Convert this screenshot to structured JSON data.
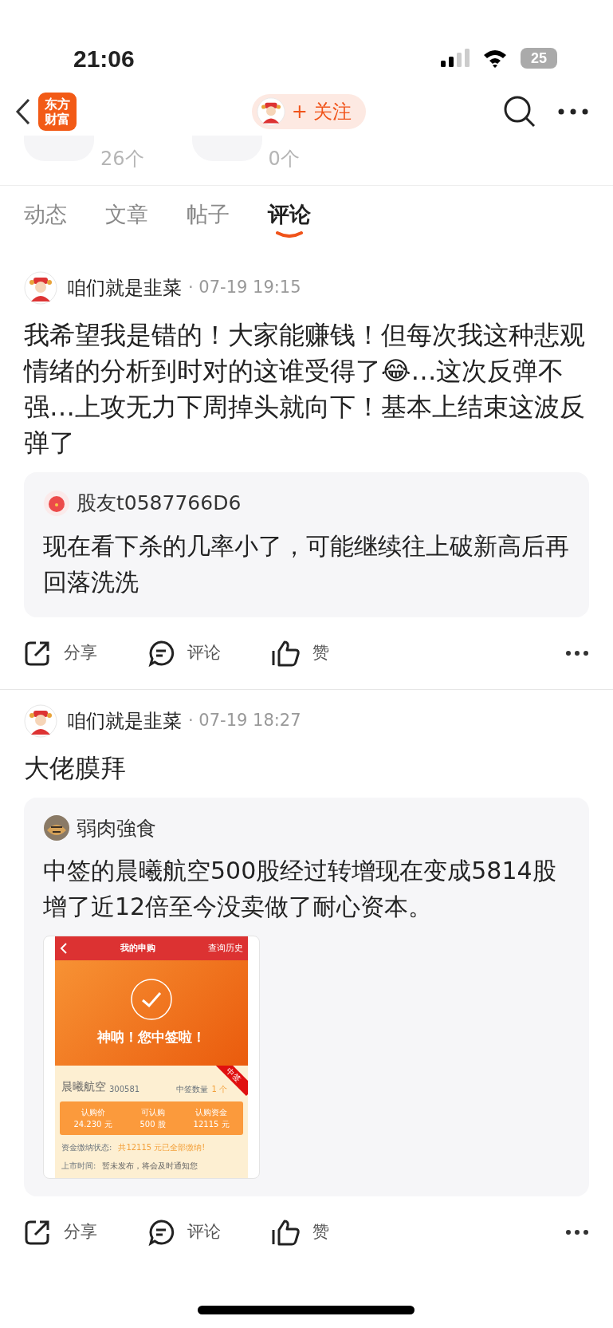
{
  "status_bar": {
    "time": "21:06",
    "battery": "25"
  },
  "header": {
    "logo_lines": [
      "东方",
      "财富"
    ],
    "follow_button": "+ 关注"
  },
  "stats": [
    {
      "count": "26个"
    },
    {
      "count": "0个"
    }
  ],
  "tabs": [
    {
      "label": "动态",
      "selected": false
    },
    {
      "label": "文章",
      "selected": false
    },
    {
      "label": "帖子",
      "selected": false
    },
    {
      "label": "评论",
      "selected": true
    }
  ],
  "posts": [
    {
      "author": "咱们就是韭菜",
      "time": "· 07-19 19:15",
      "text": "我希望我是错的！大家能赚钱！但每次我这种悲观情绪的分析到时对的这谁受得了😂…这次反弹不强…上攻无力下周掉头就向下！基本上结束这波反弹了",
      "quote": {
        "author": "股友t0587766D6",
        "text": "现在看下杀的几率小了，可能继续往上破新高后再回落洗洗"
      },
      "actions": [
        "分享",
        "评论",
        "赞"
      ]
    },
    {
      "author": "咱们就是韭菜",
      "time": "· 07-19 18:27",
      "text": "大佬膜拜",
      "quote": {
        "author": "弱肉強食",
        "text": "中签的晨曦航空500股经过转增现在变成5814股增了近12倍至今没卖做了耐心资本。",
        "screenshot": {
          "title": "我的申购",
          "link": "查询历史",
          "banner": "神呐！您中签啦！",
          "ribbon": "中签",
          "stock": "晨曦航空",
          "code": "300581",
          "count_label": "中签数量",
          "count": "1",
          "count_unit": "个",
          "fields": [
            {
              "label": "认购价",
              "value": "24.230",
              "unit": "元"
            },
            {
              "label": "可认购",
              "value": "500",
              "unit": "股"
            },
            {
              "label": "认购资金",
              "value": "12115",
              "unit": "元"
            }
          ],
          "status": [
            {
              "label": "资金缴纳状态:",
              "value": "共12115 元已全部缴纳!"
            },
            {
              "label": "上市时间:",
              "value": "暂未发布，将会及时通知您"
            }
          ]
        }
      },
      "actions": [
        "分享",
        "评论",
        "赞"
      ]
    }
  ]
}
